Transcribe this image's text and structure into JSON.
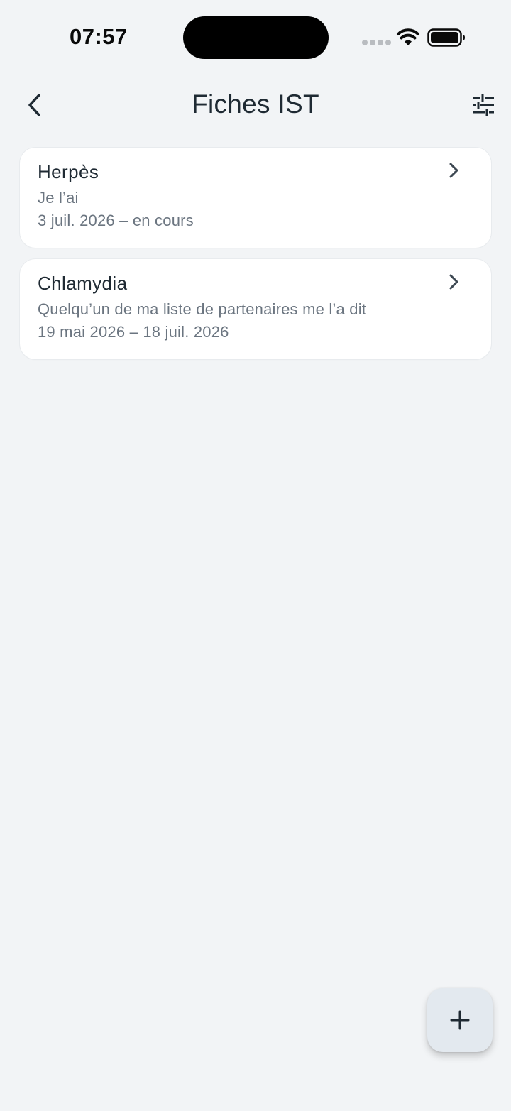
{
  "status_bar": {
    "time": "07:57"
  },
  "header": {
    "title": "Fiches IST",
    "back_icon": "chevron-left-icon",
    "filter_icon": "sliders-icon"
  },
  "cards": [
    {
      "title": "Herpès",
      "subtitle": "Je l’ai",
      "dates": "3 juil. 2026 – en cours"
    },
    {
      "title": "Chlamydia",
      "subtitle": "Quelqu’un de ma liste de partenaires me l’a dit",
      "dates": "19 mai 2026 – 18 juil. 2026"
    }
  ],
  "fab": {
    "icon": "plus-icon"
  },
  "colors": {
    "background": "#f2f4f6",
    "card": "#ffffff",
    "title_text": "#1f2a33",
    "secondary_text": "#6b7580",
    "fab_background": "#e3e9ef"
  }
}
